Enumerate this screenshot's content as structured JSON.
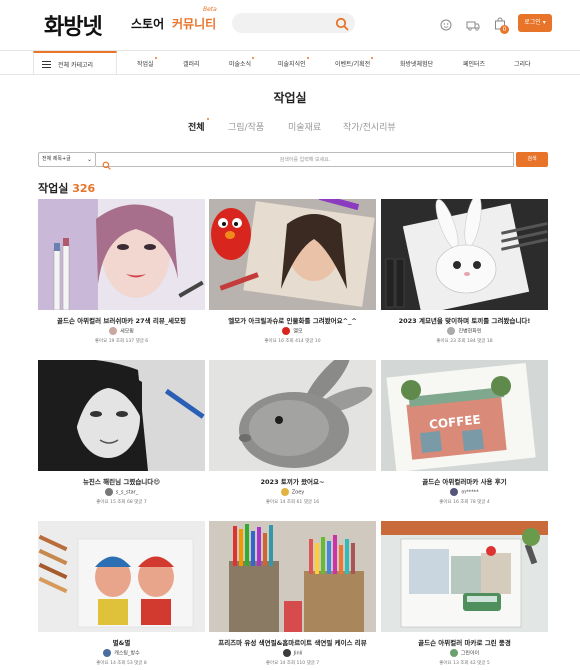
{
  "header": {
    "logo": "화방넷",
    "nav": {
      "store": "스토어",
      "community": "커뮤니티",
      "beta": "Beta"
    },
    "cart_count": "0",
    "login_label": "로그인"
  },
  "category_bar": {
    "all_label": "전체 카테고리",
    "items": [
      {
        "label": "작업실",
        "dot": true
      },
      {
        "label": "갤러리",
        "dot": false
      },
      {
        "label": "미술소식",
        "dot": true
      },
      {
        "label": "미술지식인",
        "dot": true
      },
      {
        "label": "이벤트/기획전",
        "dot": true
      },
      {
        "label": "화방넷체험단",
        "dot": false
      },
      {
        "label": "페인터즈",
        "dot": false
      },
      {
        "label": "그리다",
        "dot": false
      }
    ]
  },
  "page": {
    "title": "작업실",
    "tabs": [
      {
        "label": "전체",
        "active": true
      },
      {
        "label": "그림/작품",
        "active": false
      },
      {
        "label": "미술재료",
        "active": false
      },
      {
        "label": "작가/전시리뷰",
        "active": false
      }
    ],
    "search": {
      "select_value": "전체 제목+글",
      "placeholder": "검색어를 입력해 보세요.",
      "button": "검색"
    },
    "count_label": "작업실",
    "count_value": "326"
  },
  "colors": {
    "accent": "#e8742a"
  },
  "cards": [
    {
      "title": "골드슨 아뮈컬러 브러쉬마카 27색 리뷰_세모핑",
      "author": "세모핑",
      "stats": "좋아요 19 조회 137 댓글 6",
      "icon": "avatar"
    },
    {
      "title": "엘모가 아크릴과슈로 인물화를 그려봤어요^_^",
      "author": "엘모",
      "stats": "좋아요 16 조회 414 댓글 10",
      "icon": "avatar"
    },
    {
      "title": "2023 계묘년을 맞이하며 토끼를 그려봤습니다!",
      "author": "진병현화린",
      "stats": "좋아요 23 조회 184 댓글 18",
      "icon": "avatar"
    },
    {
      "title": "뉴진스 해린님 그렸습니다😄",
      "author": "s_s_star_",
      "stats": "좋아요 15 조회 68 댓글 7",
      "icon": "avatar"
    },
    {
      "title": "2023 토끼가 왔어요~",
      "author": "Zoey",
      "stats": "좋아요 14 조회 61 댓글 16",
      "icon": "avatar"
    },
    {
      "title": "골드슨 아뮈컬러마카 사용 후기",
      "author": "m*****",
      "stats": "좋아요 16 조회 78 댓글 4",
      "icon": "avatar"
    },
    {
      "title": "별&별",
      "author": "캐스팅_방수",
      "stats": "좋아요 14 조회 53 댓글 8",
      "icon": "avatar"
    },
    {
      "title": "프리즈마 유성 색연필&홈마르이트 색연필 케이스 리뷰",
      "author": "Jinli",
      "stats": "좋아요 14 조회 110 댓글 7",
      "icon": "avatar"
    },
    {
      "title": "골드슨 아뮈컬러 마카로 그린 풍경",
      "author": "그린아이",
      "stats": "좋아요 13 조회 42 댓글 5",
      "icon": "avatar"
    }
  ]
}
